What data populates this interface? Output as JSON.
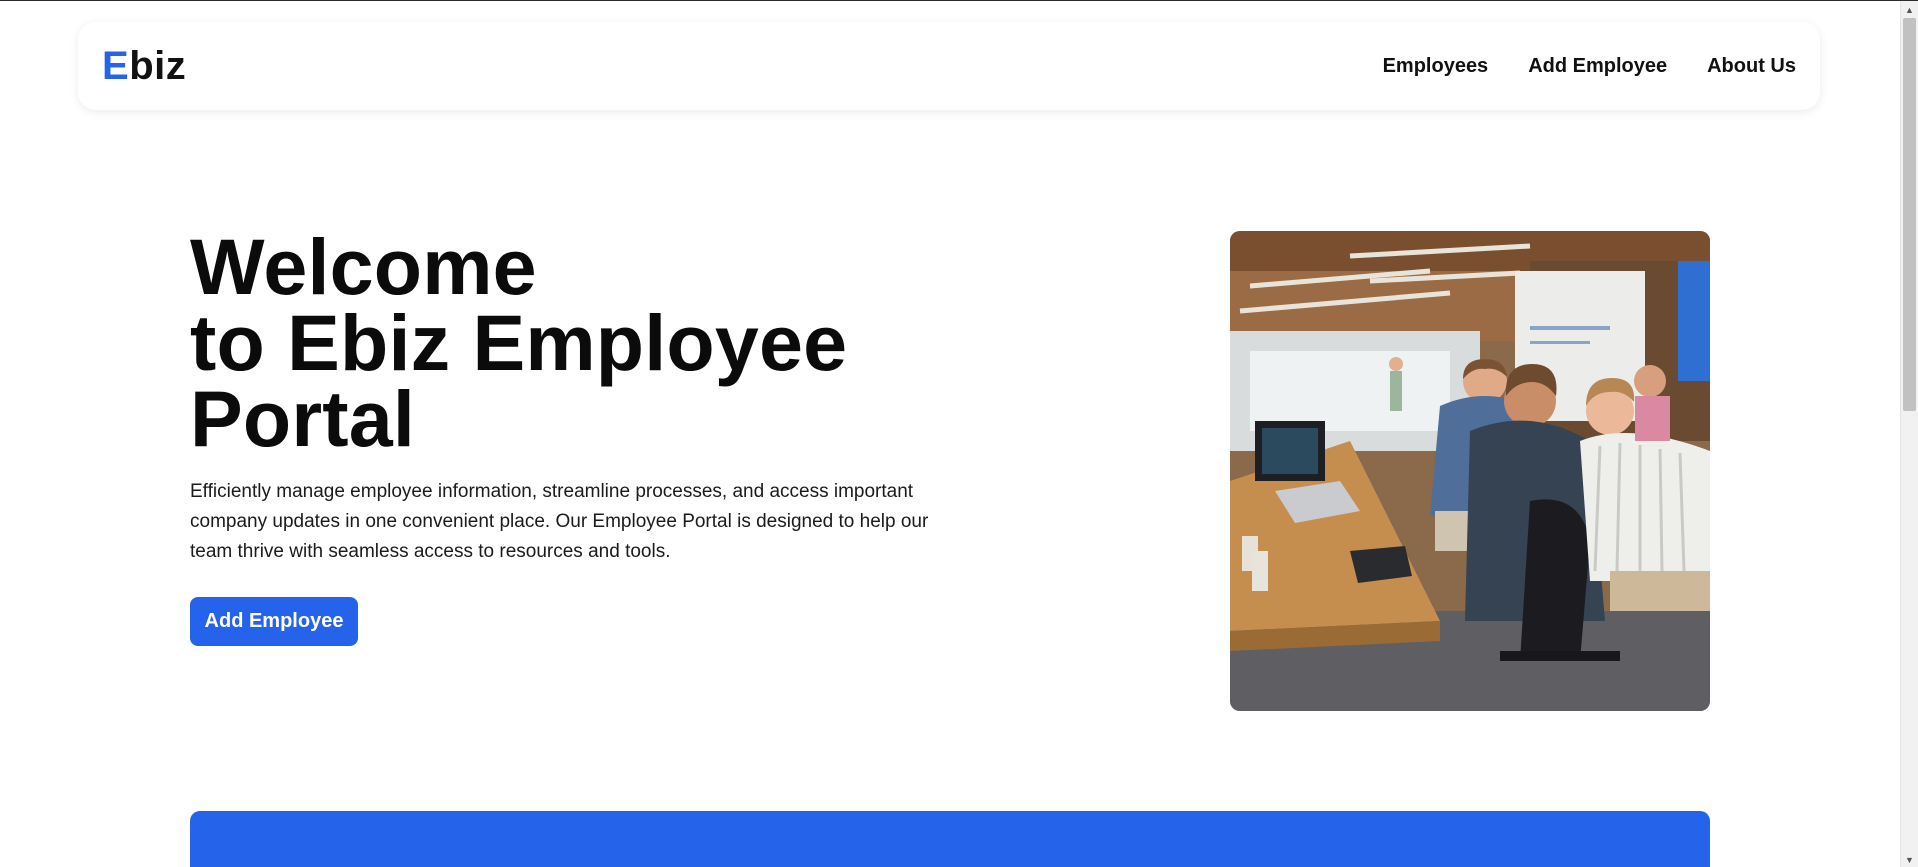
{
  "navbar": {
    "logo_first": "E",
    "logo_rest": "biz",
    "links": [
      {
        "label": "Employees"
      },
      {
        "label": "Add Employee"
      },
      {
        "label": "About Us"
      }
    ]
  },
  "hero": {
    "title_line1": "Welcome",
    "title_line2": "to Ebiz Employee",
    "title_line3": "Portal",
    "description": "Efficiently manage employee information, streamline processes, and access important company updates in one convenient place. Our Employee Portal is designed to help our team thrive with seamless access to resources and tools.",
    "cta_label": "Add Employee"
  },
  "colors": {
    "accent": "#2563eb",
    "text": "#0b0b0b",
    "background": "#ffffff"
  },
  "icons": {
    "scroll_up": "triangle-up-icon",
    "scroll_down": "triangle-down-icon"
  }
}
